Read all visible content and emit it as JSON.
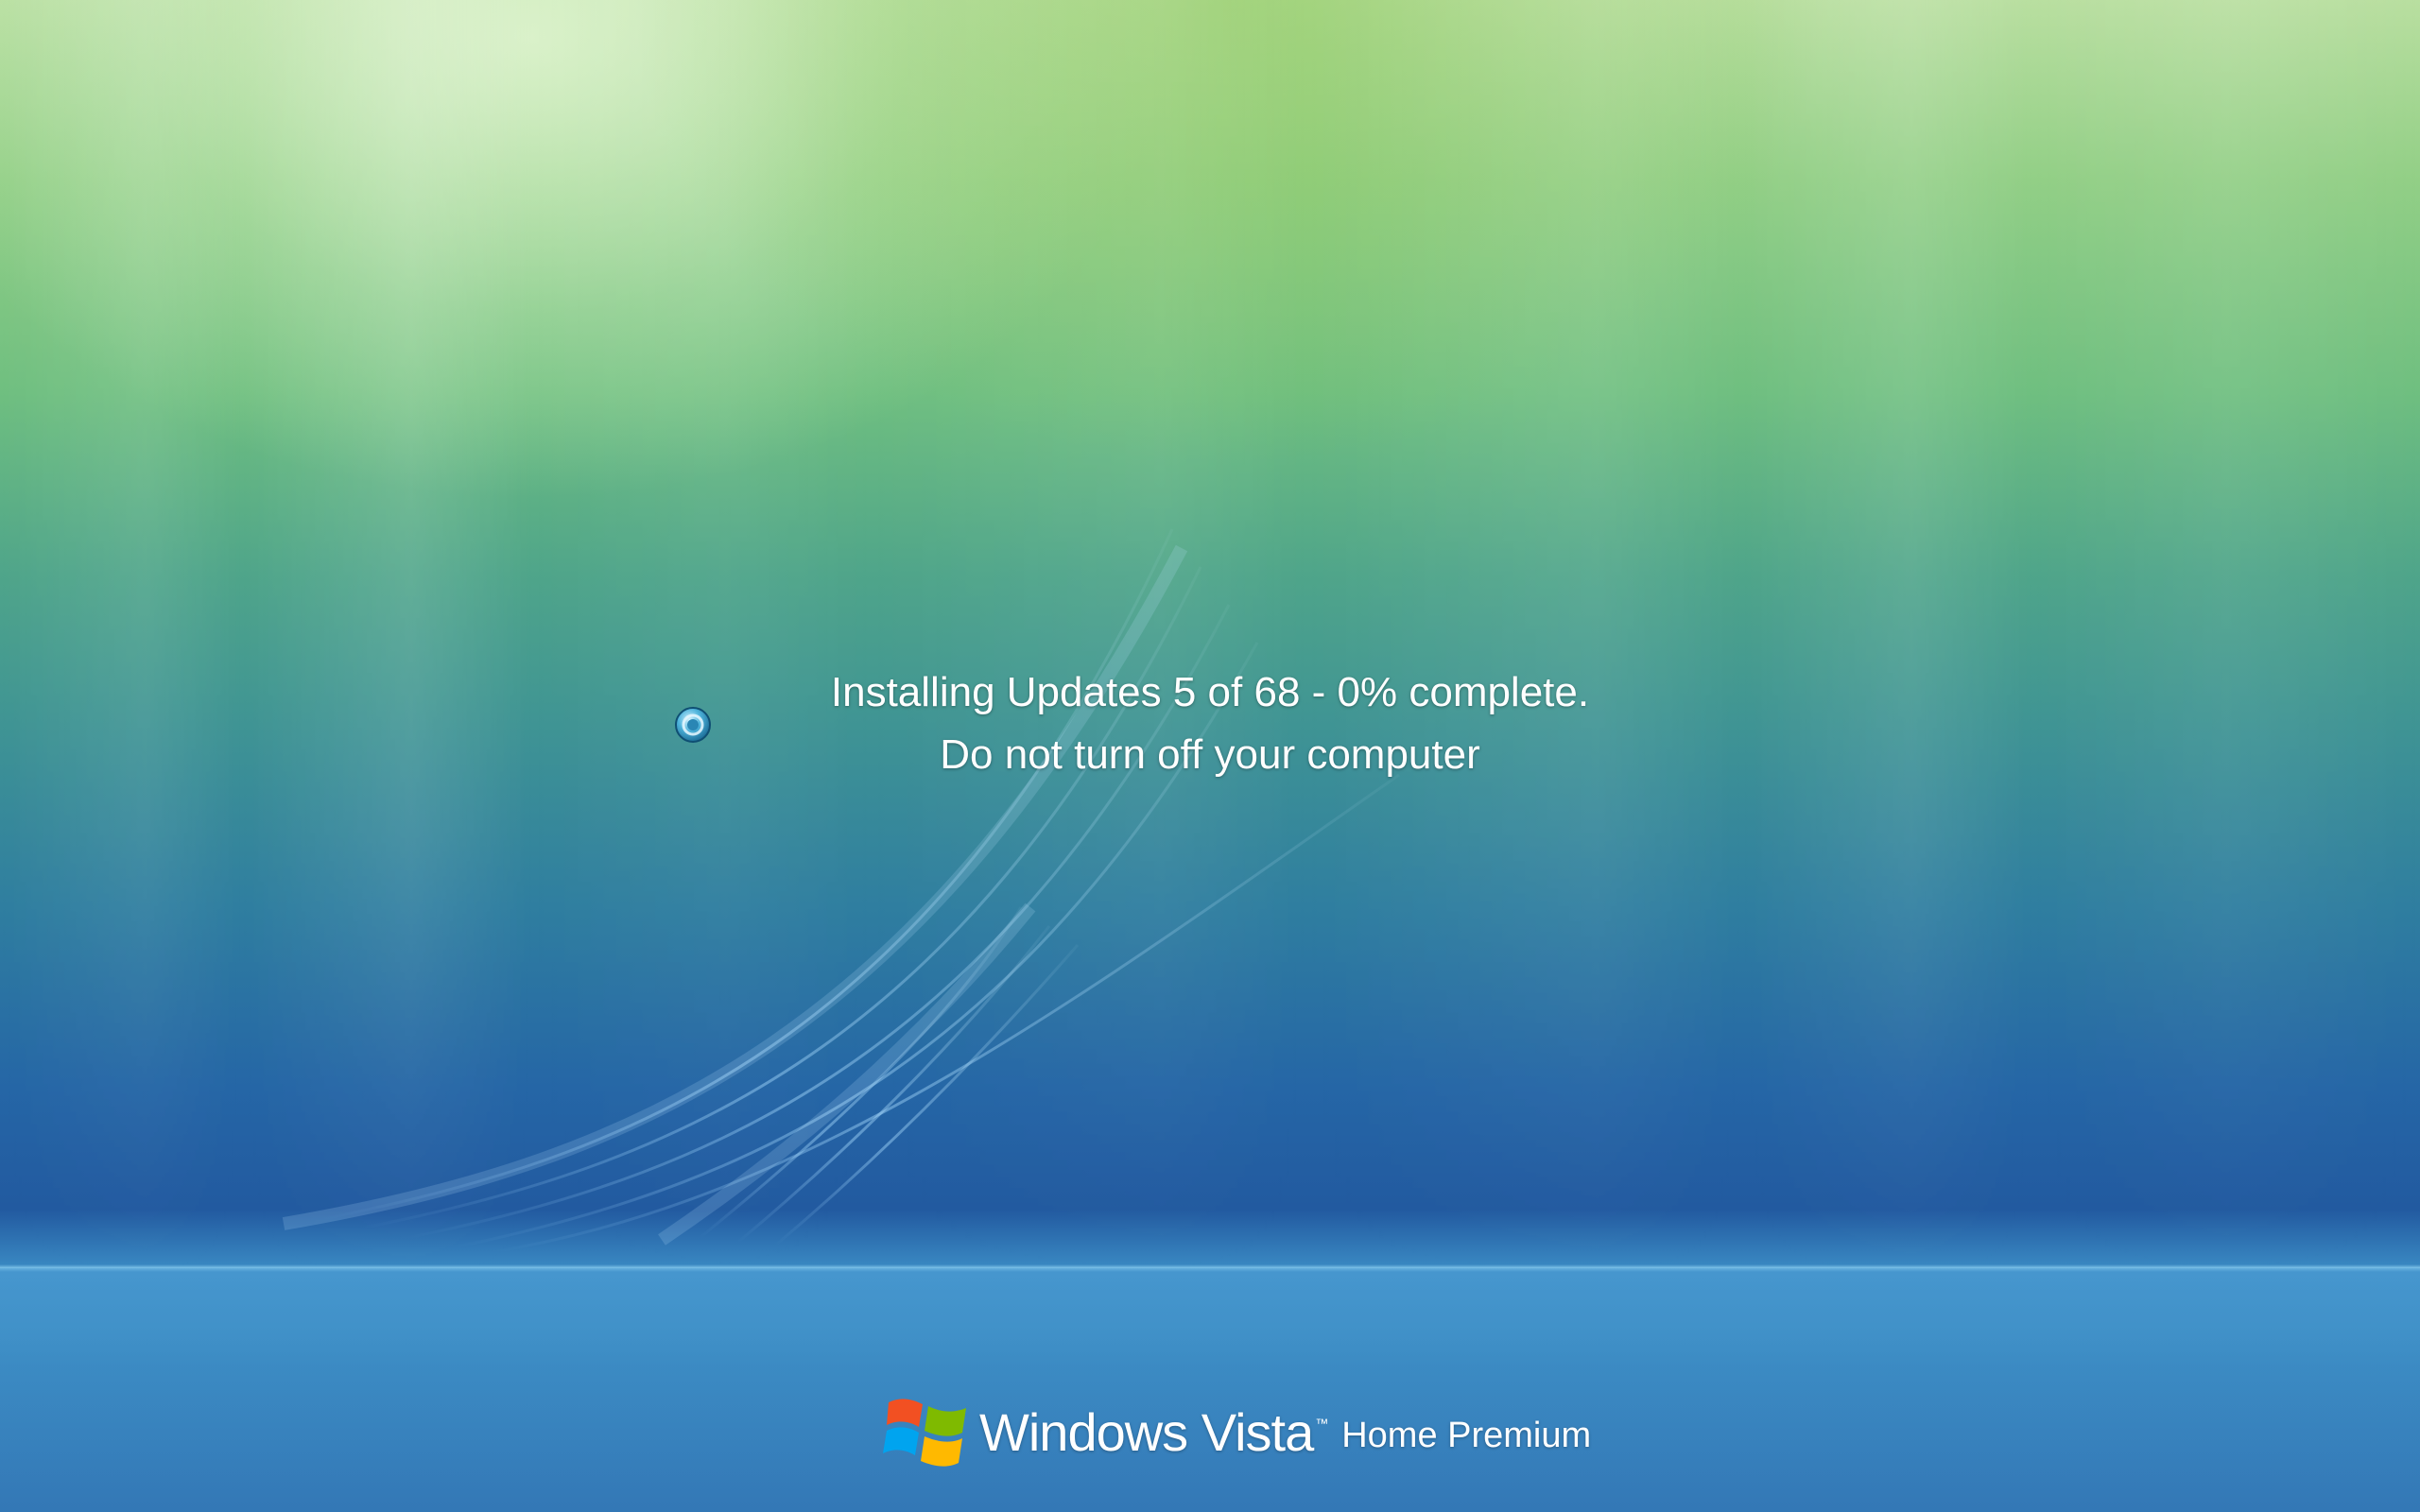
{
  "screen": {
    "type": "update-installation-screen",
    "colors": {
      "top": "#b9dfa0",
      "middle": "#3f9494",
      "bottom": "#225aa0",
      "text": "#ffffff"
    }
  },
  "status": {
    "line1": "Installing Updates 5 of 68 - 0% complete.",
    "line2": "Do not turn off your computer",
    "current_update": 5,
    "total_updates": 68,
    "percent_complete": 0
  },
  "spinner": {
    "icon": "spinner-icon"
  },
  "brand": {
    "logo_icon": "windows-flag-icon",
    "name": "Windows Vista",
    "trademark": "™",
    "edition": "Home Premium"
  }
}
